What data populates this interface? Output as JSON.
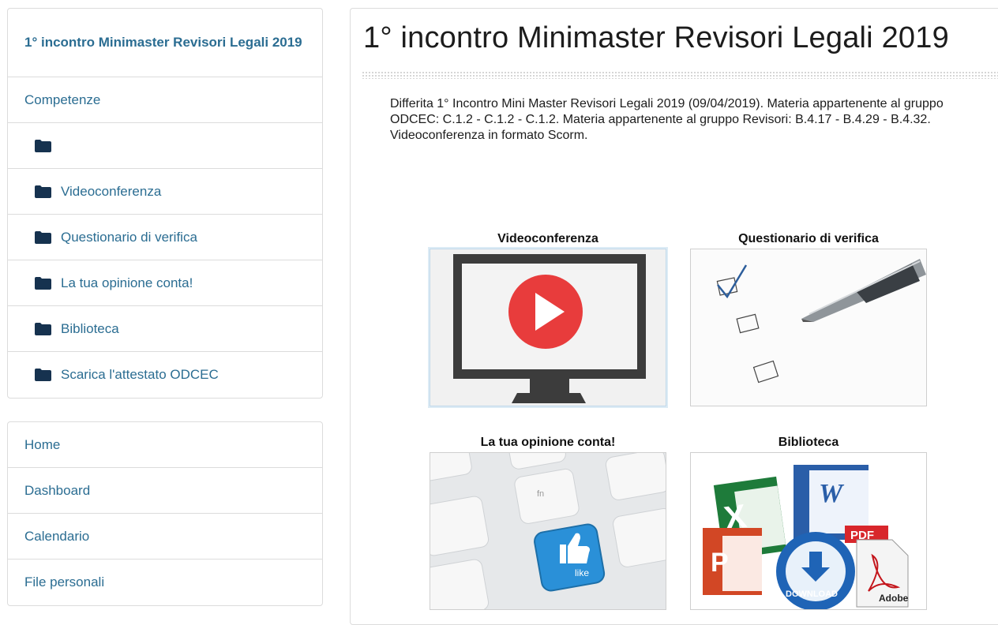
{
  "sidebar": {
    "course_title": "1° incontro Minimaster Revisori Legali 2019",
    "items": [
      {
        "label": "Competenze"
      },
      {
        "label": ""
      },
      {
        "label": "Videoconferenza"
      },
      {
        "label": "Questionario di verifica"
      },
      {
        "label": "La tua opinione conta!"
      },
      {
        "label": "Biblioteca"
      },
      {
        "label": "Scarica l'attestato ODCEC"
      }
    ],
    "nav": [
      {
        "label": "Home"
      },
      {
        "label": "Dashboard"
      },
      {
        "label": "Calendario"
      },
      {
        "label": "File personali"
      }
    ]
  },
  "main": {
    "title": "1° incontro Minimaster Revisori Legali 2019",
    "description": "Differita 1° Incontro Mini Master Revisori Legali 2019 (09/04/2019). Materia appartenente al gruppo ODCEC: C.1.2 - C.1.2 - C.1.2. Materia appartenente al gruppo Revisori: B.4.17 - B.4.29 - B.4.32. Videoconferenza in formato Scorm.",
    "tiles": [
      {
        "label": "Videoconferenza"
      },
      {
        "label": "Questionario di verifica"
      },
      {
        "label": "La tua opinione conta!"
      },
      {
        "label": "Biblioteca"
      }
    ],
    "graphics": {
      "keyboard_fn": "fn",
      "like_text": "like",
      "pdf_badge": "PDF",
      "download_text": "DOWNLOAD",
      "adobe_text": "Adobe"
    }
  },
  "colors": {
    "link": "#2b6d92",
    "folder_icon": "#16324f",
    "play_red": "#e83c3c"
  }
}
